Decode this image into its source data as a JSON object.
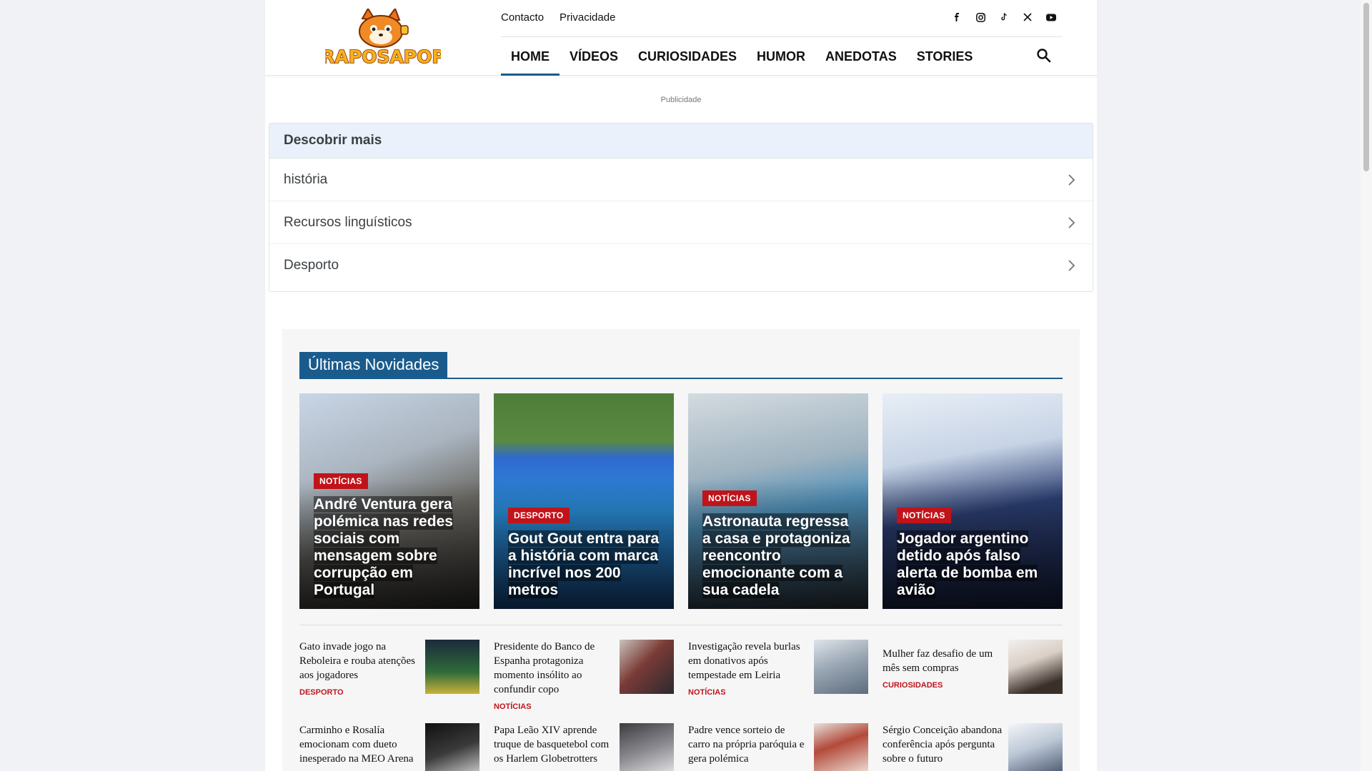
{
  "header": {
    "logo_text": "RAPOSAPOP",
    "top_links": [
      "Contacto",
      "Privacidade"
    ],
    "social_icons": [
      "facebook-icon",
      "instagram-icon",
      "tiktok-icon",
      "x-icon",
      "youtube-icon"
    ],
    "nav": [
      "HOME",
      "VÍDEOS",
      "CURIOSIDADES",
      "HUMOR",
      "ANEDOTAS",
      "STORIES"
    ],
    "active_nav": "HOME"
  },
  "ad_label": "Publicidade",
  "discover": {
    "title": "Descobrir mais",
    "items": [
      "história",
      "Recursos linguísticos",
      "Desporto"
    ]
  },
  "section": {
    "title": "Últimas Novidades",
    "featured": [
      {
        "category": "NOTÍCIAS",
        "title": "André Ventura gera polémica nas redes sociais com mensagem sobre corrupção em Portugal"
      },
      {
        "category": "DESPORTO",
        "title": "Gout Gout entra para a história com marca incrível nos 200 metros"
      },
      {
        "category": "NOTÍCIAS",
        "title": "Astronauta regressa a casa e protagoniza reencontro emocionante com a sua cadela"
      },
      {
        "category": "NOTÍCIAS",
        "title": "Jogador argentino detido após falso alerta de bomba em avião"
      }
    ],
    "list": [
      {
        "title": "Gato invade jogo na Reboleira e rouba atenções aos jogadores",
        "category": "DESPORTO"
      },
      {
        "title": "Presidente do Banco de Espanha protagoniza momento insólito ao confundir copo",
        "category": "NOTÍCIAS"
      },
      {
        "title": "Investigação revela burlas em donativos após tempestade em Leiria",
        "category": "NOTÍCIAS"
      },
      {
        "title": "Mulher faz desafio de um mês sem compras",
        "category": "CURIOSIDADES"
      },
      {
        "title": "Carminho e Rosalía emocionam com dueto inesperado na MEO Arena",
        "category": ""
      },
      {
        "title": "Papa Leão XIV aprende truque de basquetebol com os Harlem Globetrotters",
        "category": ""
      },
      {
        "title": "Padre vence sorteio de carro na própria paróquia e gera polémica",
        "category": ""
      },
      {
        "title": "Sérgio Conceição abandona conferência após pergunta sobre o futuro",
        "category": ""
      }
    ]
  },
  "colors": {
    "accent": "#1a5b8d",
    "badge": "#c0141a",
    "discover_head": "#eaf1fb"
  }
}
